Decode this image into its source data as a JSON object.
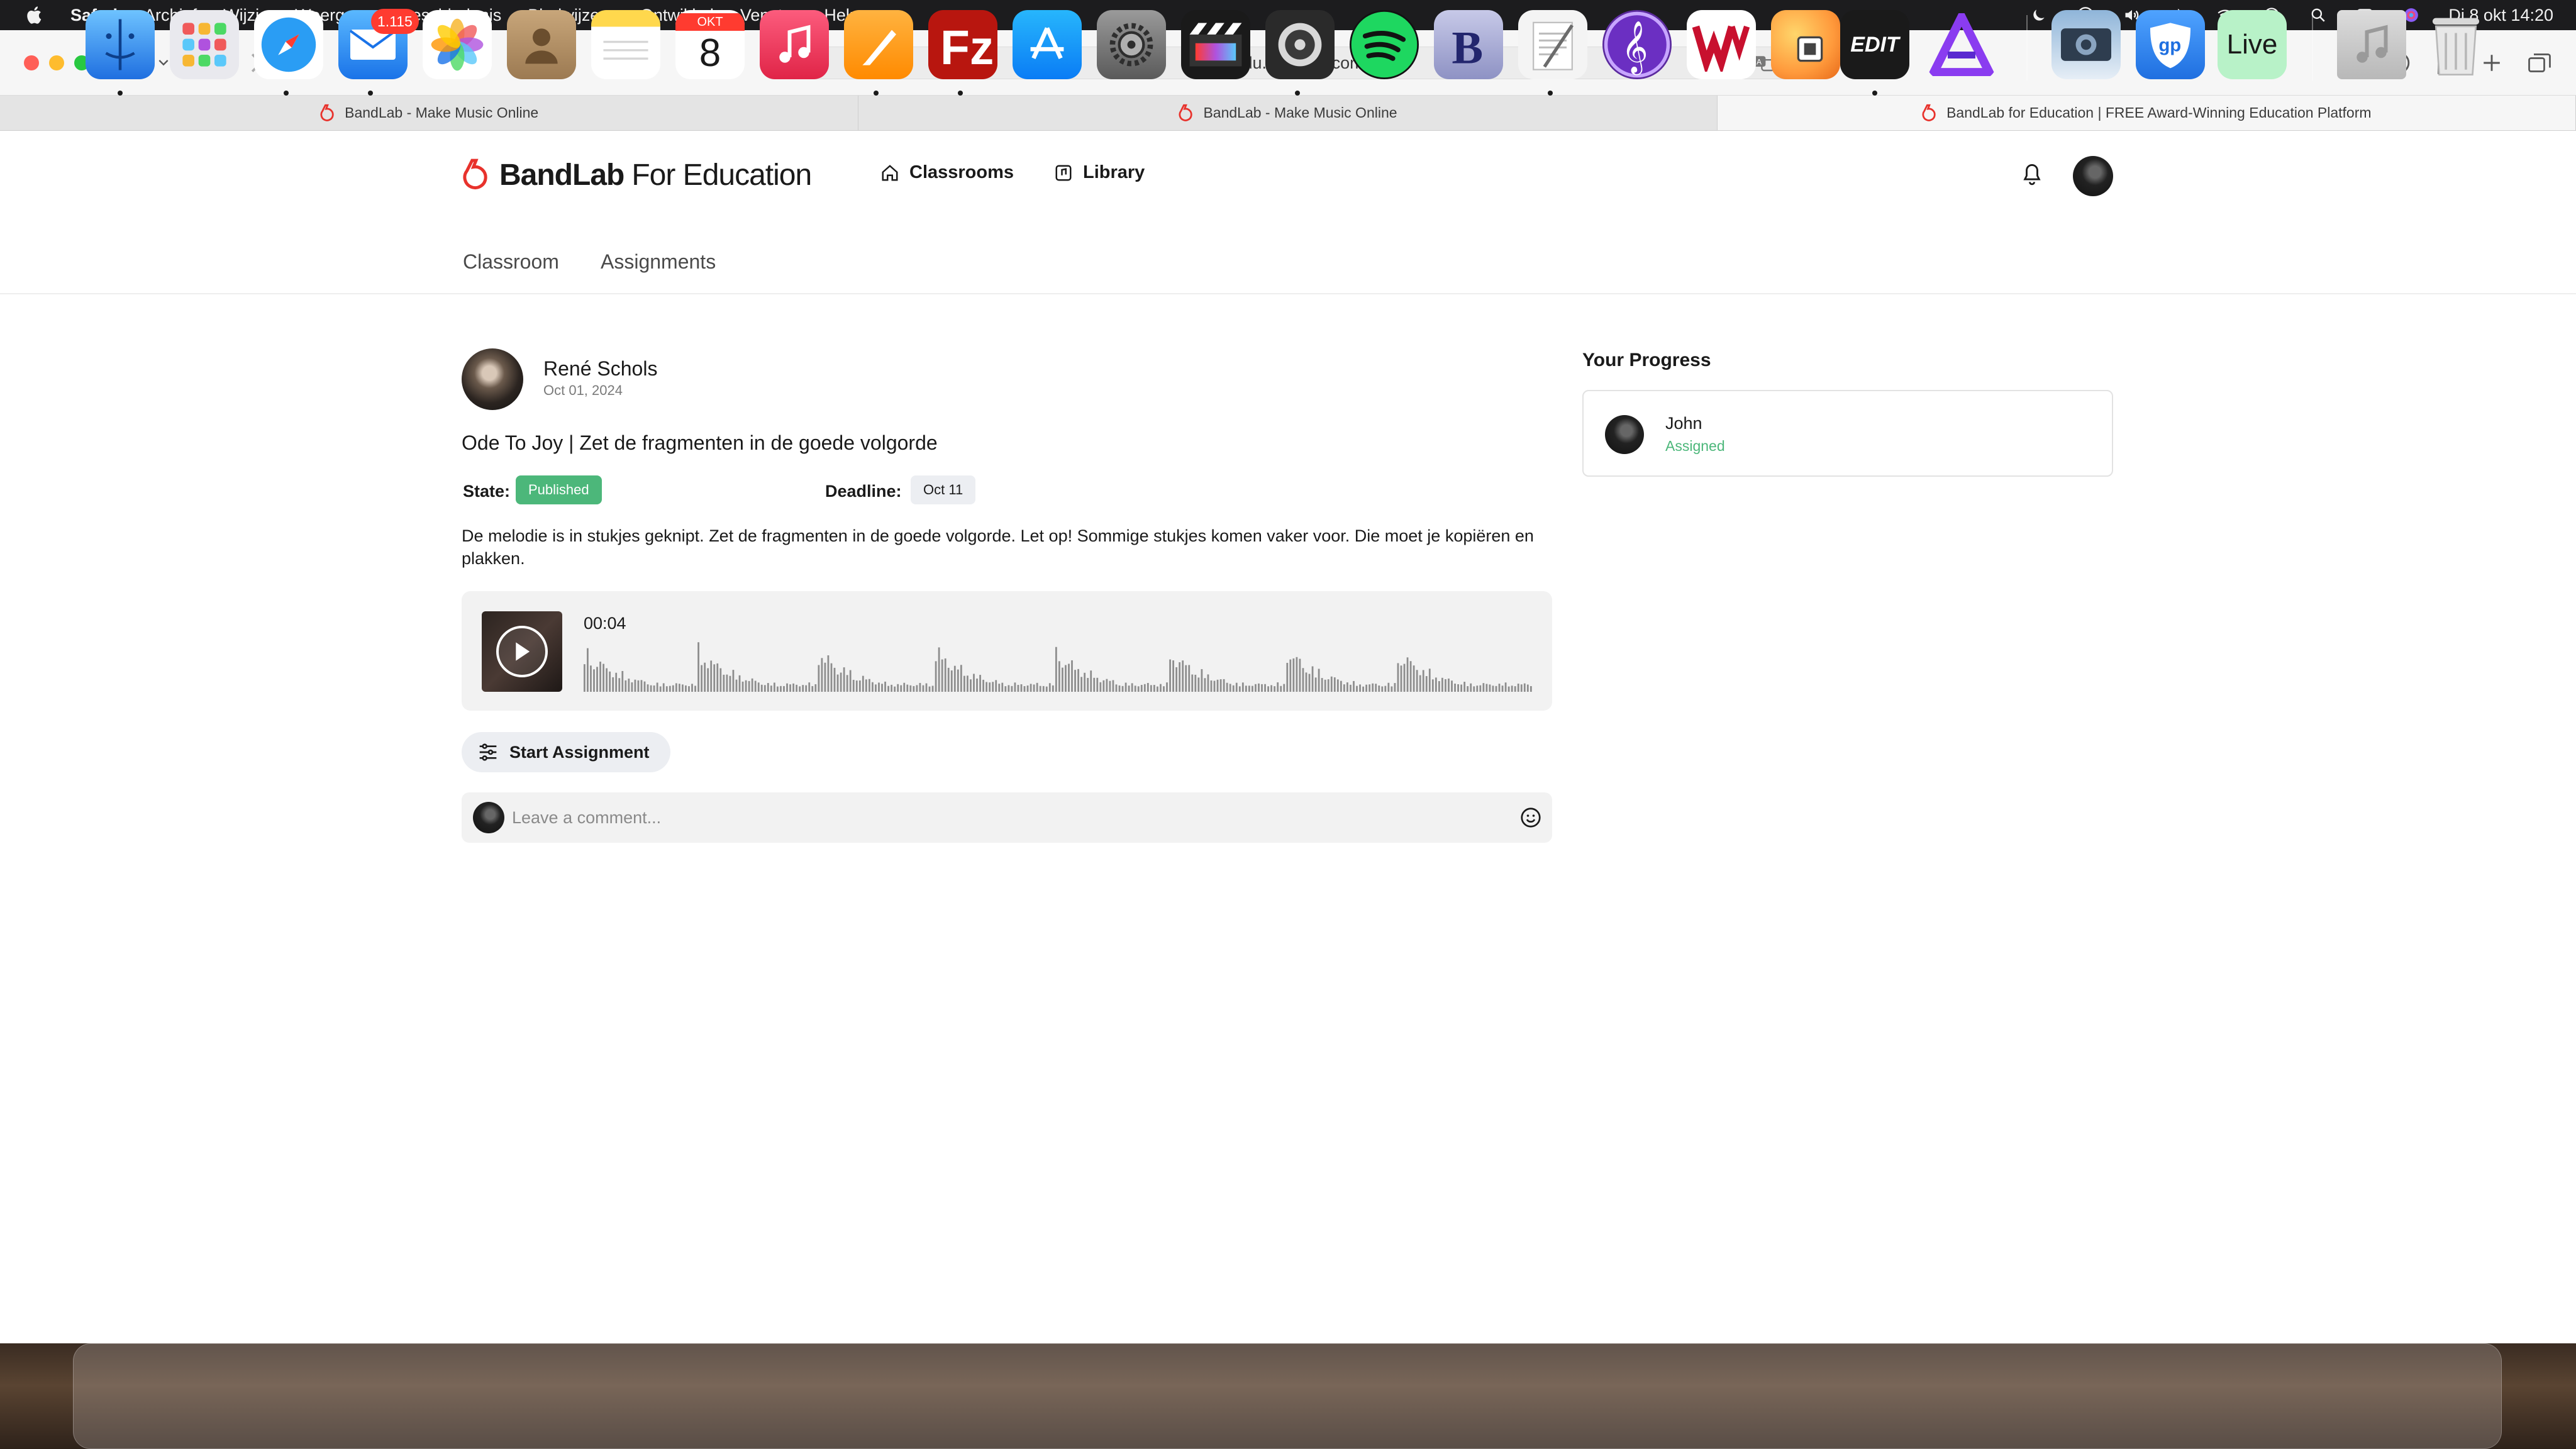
{
  "menubar": {
    "app_name": "Safari",
    "items": [
      "Archief",
      "Wijzig",
      "Weergave",
      "Geschiedenis",
      "Bladwijzers",
      "Ontwikkel",
      "Venster",
      "Help"
    ],
    "clock": "Di 8 okt  14:20"
  },
  "browser": {
    "url": "edu.bandlab.com",
    "tabs": [
      {
        "title": "BandLab - Make Music Online",
        "active": false
      },
      {
        "title": "BandLab - Make Music Online",
        "active": false
      },
      {
        "title": "BandLab for Education | FREE Award-Winning Education Platform",
        "active": true
      }
    ]
  },
  "site": {
    "brand": "BandLab",
    "brand_sub": "For Education",
    "brand_color": "#e8322c",
    "nav": {
      "classrooms": "Classrooms",
      "library": "Library"
    },
    "subtabs": {
      "classroom": "Classroom",
      "assignments": "Assignments"
    }
  },
  "assignment": {
    "author": "René Schols",
    "date": "Oct 01, 2024",
    "title": "Ode To Joy | Zet de fragmenten in de goede volgorde",
    "state_label": "State:",
    "state": "Published",
    "state_color": "#4cb77a",
    "deadline_label": "Deadline:",
    "deadline": "Oct 11",
    "description": "De melodie is in stukjes geknipt. Zet de fragmenten in de goede volgorde. Let op! Sommige stukjes komen vaker voor. Die moet je kopiëren en plakken.",
    "audio_time": "00:04",
    "start_button": "Start Assignment",
    "comment_placeholder": "Leave a comment..."
  },
  "progress": {
    "title": "Your Progress",
    "students": [
      {
        "name": "John",
        "status": "Assigned"
      }
    ]
  },
  "dock": {
    "mail_badge": "1.115",
    "calendar_month": "OKT",
    "calendar_day": "8",
    "xedit_label": "EDIT",
    "live_label": "Live",
    "apps": [
      "finder",
      "launchpad",
      "safari",
      "mail",
      "photos",
      "contacts",
      "notes",
      "calendar",
      "music",
      "pages",
      "filezilla",
      "app-store",
      "system-settings",
      "final-cut-pro",
      "logic-pro",
      "spotify",
      "bbedit",
      "textedit",
      "musescore",
      "wavelab",
      "pixelmator",
      "preview",
      "x32-edit",
      "affinity",
      "image-capture",
      "guitar-pro",
      "ableton-live",
      "downloads",
      "trash"
    ]
  }
}
